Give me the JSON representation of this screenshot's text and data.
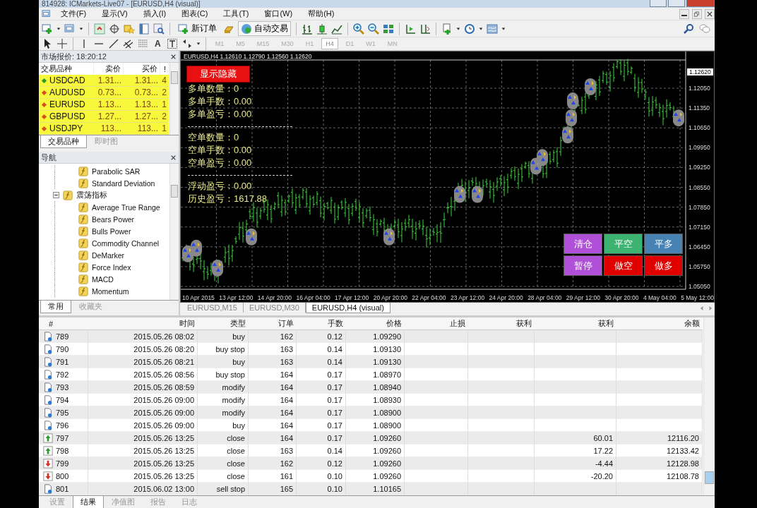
{
  "window": {
    "title": "814928: ICMarkets-Live07 - [EURUSD,H4 (visual)]"
  },
  "menu": [
    "文件(F)",
    "显示(V)",
    "插入(I)",
    "图表(C)",
    "工具(T)",
    "窗口(W)",
    "帮助(H)"
  ],
  "toolbar": {
    "new_order": "新订单",
    "auto_trading": "自动交易",
    "text_tool": "A",
    "timeframes": [
      {
        "label": "M1",
        "selected": false
      },
      {
        "label": "M5",
        "selected": false
      },
      {
        "label": "M15",
        "selected": false
      },
      {
        "label": "M30",
        "selected": false
      },
      {
        "label": "H1",
        "selected": false
      },
      {
        "label": "H4",
        "selected": true
      },
      {
        "label": "D1",
        "selected": false
      },
      {
        "label": "W1",
        "selected": false
      },
      {
        "label": "MN",
        "selected": false
      }
    ]
  },
  "market_watch": {
    "title": "市场报价: 18:20:12",
    "columns": [
      "交易品种",
      "卖价",
      "买价",
      "!"
    ],
    "rows": [
      {
        "kind": "up",
        "symbol": "USDCAD",
        "bid": "1.31...",
        "ask": "1.31...",
        "count": "4"
      },
      {
        "kind": "down",
        "symbol": "AUDUSD",
        "bid": "0.73...",
        "ask": "0.73...",
        "count": "2"
      },
      {
        "kind": "down",
        "symbol": "EURUSD",
        "bid": "1.13...",
        "ask": "1.13...",
        "count": "1"
      },
      {
        "kind": "down",
        "symbol": "GBPUSD",
        "bid": "1.27...",
        "ask": "1.27...",
        "count": "2"
      },
      {
        "kind": "down",
        "symbol": "USDJPY",
        "bid": "113...",
        "ask": "113...",
        "count": "1"
      }
    ],
    "tabs": [
      {
        "label": "交易品种",
        "selected": true
      },
      {
        "label": "即时图",
        "selected": false
      }
    ]
  },
  "navigator": {
    "title": "导航",
    "items": [
      {
        "label": "Parabolic SAR"
      },
      {
        "label": "Standard Deviation"
      }
    ],
    "folders": [
      {
        "label": "震荡指标",
        "expanded": true,
        "children": [
          {
            "label": "Average True Range"
          },
          {
            "label": "Bears Power"
          },
          {
            "label": "Bulls Power"
          },
          {
            "label": "Commodity Channel"
          },
          {
            "label": "DeMarker"
          },
          {
            "label": "Force Index"
          },
          {
            "label": "MACD"
          },
          {
            "label": "Momentum"
          }
        ]
      }
    ],
    "tabs": [
      {
        "label": "常用",
        "selected": true
      },
      {
        "label": "收藏夹",
        "selected": false
      }
    ]
  },
  "chart": {
    "header": "EURUSD,H4  1.12610 1.12790 1.12560 1.12620",
    "toggle_button": "显示隐藏",
    "stat_groups": [
      {
        "lines": [
          "多单数量：0",
          "多单手数：0.00",
          "多单盈亏：0.00"
        ]
      },
      {
        "lines": [
          "空单数量：0",
          "空单手数：0.00",
          "空单盈亏：0.00"
        ]
      },
      {
        "lines": [
          "浮动盈亏：0.00",
          "历史盈亏：1617.88"
        ]
      }
    ],
    "buttons": [
      {
        "label": "清仓",
        "color": "#b050d8"
      },
      {
        "label": "平空",
        "color": "#3cb371"
      },
      {
        "label": "平多",
        "color": "#4682b4"
      },
      {
        "label": "暂停",
        "color": "#b050d8"
      },
      {
        "label": "做空",
        "color": "#e00000"
      },
      {
        "label": "做多",
        "color": "#e00000"
      }
    ],
    "current_price": "1.12620",
    "price_labels": [
      "1.12050",
      "1.11350",
      "1.10650",
      "1.09950",
      "1.09250",
      "1.08550",
      "1.07850",
      "1.07150",
      "1.06450",
      "1.05750",
      "1.05050"
    ],
    "time_labels": [
      "10 Apr 2015",
      "13 Apr 12:00",
      "14 Apr 20:00",
      "16 Apr 04:00",
      "17 Apr 12:00",
      "20 Apr 20:00",
      "22 Apr 04:00",
      "23 Apr 12:00",
      "24 Apr 20:00",
      "28 Apr 04:00",
      "29 Apr 12:00",
      "30 Apr 20:00",
      "4 May 04:00",
      "5 May 12:00"
    ]
  },
  "chart_tabs": [
    {
      "label": "EURUSD,M15",
      "selected": false
    },
    {
      "label": "EURUSD,M30",
      "selected": false
    },
    {
      "label": "EURUSD,H4 (visual)",
      "selected": true
    }
  ],
  "terminal": {
    "columns": [
      "#",
      "时间",
      "类型",
      "订单",
      "手数",
      "价格",
      "止损",
      "获利",
      "获利",
      "余额"
    ],
    "rows": [
      {
        "kind": "order",
        "num": "789",
        "time": "2015.05.26 08:02",
        "type": "buy",
        "order": "162",
        "lots": "0.12",
        "price": "1.09290"
      },
      {
        "kind": "order",
        "num": "790",
        "time": "2015.05.26 08:20",
        "type": "buy stop",
        "order": "163",
        "lots": "0.14",
        "price": "1.09130"
      },
      {
        "kind": "order",
        "num": "791",
        "time": "2015.05.26 08:21",
        "type": "buy",
        "order": "163",
        "lots": "0.14",
        "price": "1.09130"
      },
      {
        "kind": "order",
        "num": "792",
        "time": "2015.05.26 08:56",
        "type": "buy stop",
        "order": "164",
        "lots": "0.17",
        "price": "1.08970"
      },
      {
        "kind": "order",
        "num": "793",
        "time": "2015.05.26 08:59",
        "type": "modify",
        "order": "164",
        "lots": "0.17",
        "price": "1.08940"
      },
      {
        "kind": "order",
        "num": "794",
        "time": "2015.05.26 09:00",
        "type": "modify",
        "order": "164",
        "lots": "0.17",
        "price": "1.08930"
      },
      {
        "kind": "order",
        "num": "795",
        "time": "2015.05.26 09:00",
        "type": "modify",
        "order": "164",
        "lots": "0.17",
        "price": "1.08900"
      },
      {
        "kind": "order",
        "num": "796",
        "time": "2015.05.26 09:00",
        "type": "buy",
        "order": "164",
        "lots": "0.17",
        "price": "1.08900"
      },
      {
        "kind": "profit",
        "num": "797",
        "time": "2015.05.26 13:25",
        "type": "close",
        "order": "164",
        "lots": "0.17",
        "price": "1.09260",
        "profit": "60.01",
        "balance": "12116.20"
      },
      {
        "kind": "profit",
        "num": "798",
        "time": "2015.05.26 13:25",
        "type": "close",
        "order": "163",
        "lots": "0.14",
        "price": "1.09260",
        "profit": "17.22",
        "balance": "12133.42"
      },
      {
        "kind": "loss",
        "num": "799",
        "time": "2015.05.26 13:25",
        "type": "close",
        "order": "162",
        "lots": "0.12",
        "price": "1.09260",
        "profit": "-4.44",
        "balance": "12128.98"
      },
      {
        "kind": "loss",
        "num": "800",
        "time": "2015.05.26 13:25",
        "type": "close",
        "order": "161",
        "lots": "0.10",
        "price": "1.09260",
        "profit": "-20.20",
        "balance": "12108.78"
      },
      {
        "kind": "order",
        "num": "801",
        "time": "2015.06.02 13:00",
        "type": "sell stop",
        "order": "165",
        "lots": "0.10",
        "price": "1.10165"
      }
    ],
    "tabs": [
      {
        "label": "设置",
        "selected": false
      },
      {
        "label": "结果",
        "selected": true
      },
      {
        "label": "净值图",
        "selected": false
      },
      {
        "label": "报告",
        "selected": false
      },
      {
        "label": "日志",
        "selected": false
      }
    ]
  }
}
